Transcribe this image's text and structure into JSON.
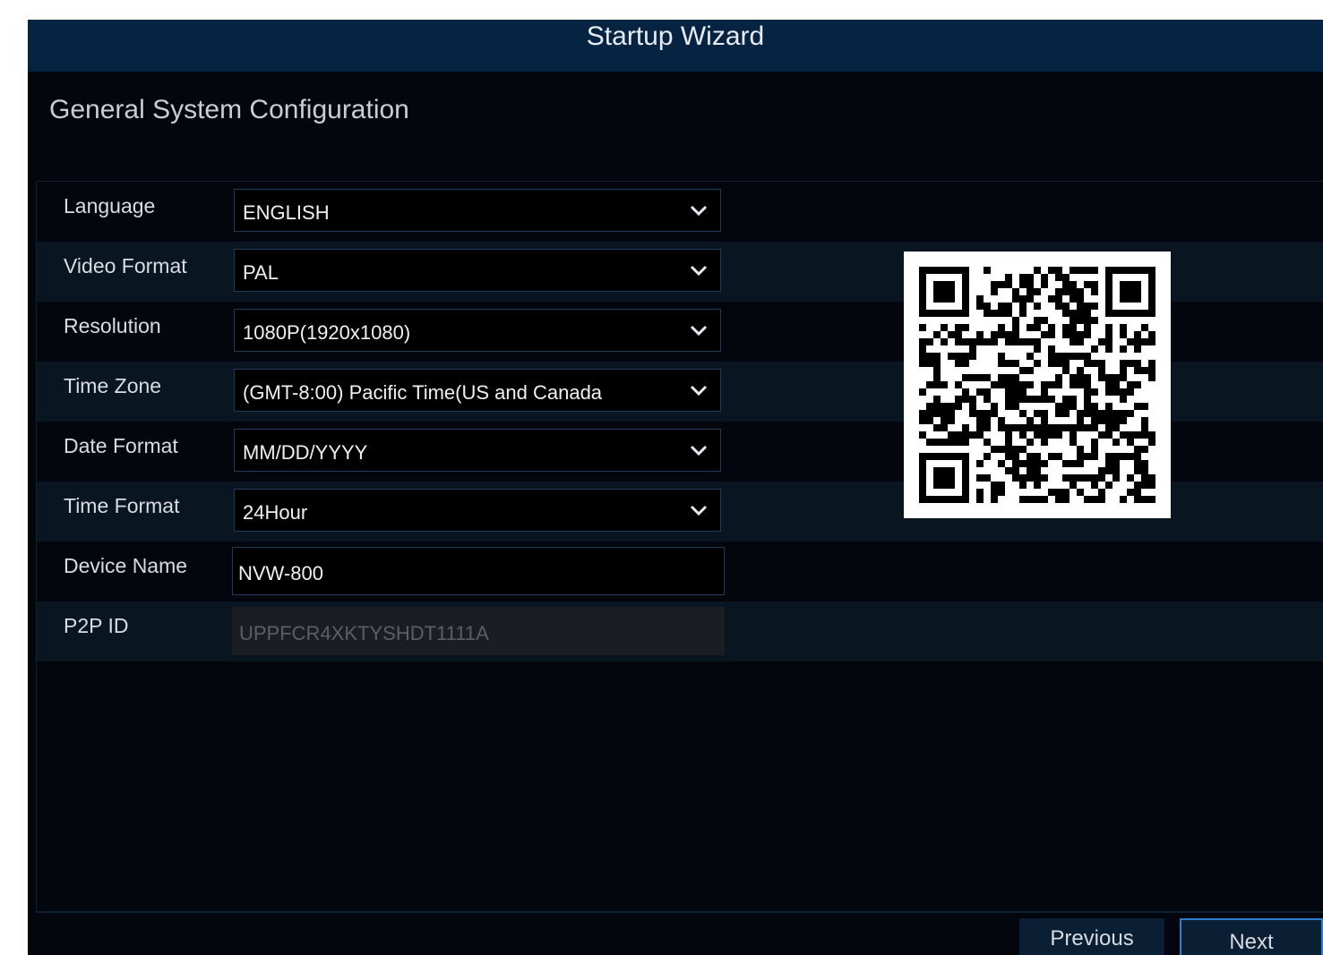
{
  "window": {
    "title": "Startup Wizard"
  },
  "section": {
    "title": "General System Configuration"
  },
  "fields": [
    {
      "label": "Language",
      "value": "ENGLISH",
      "type": "select"
    },
    {
      "label": "Video Format",
      "value": "PAL",
      "type": "select"
    },
    {
      "label": "Resolution",
      "value": "1080P(1920x1080)",
      "type": "select"
    },
    {
      "label": "Time Zone",
      "value": "(GMT-8:00) Pacific Time(US and Canada",
      "type": "select"
    },
    {
      "label": "Date Format",
      "value": "MM/DD/YYYY",
      "type": "select"
    },
    {
      "label": "Time Format",
      "value": "24Hour",
      "type": "select"
    },
    {
      "label": "Device Name",
      "value": "NVW-800",
      "type": "text"
    },
    {
      "label": "P2P ID",
      "value": "UPPFCR4XKTYSHDT1111A",
      "type": "readonly"
    }
  ],
  "buttons": {
    "previous": "Previous",
    "next": "Next"
  },
  "colors": {
    "title_bar": "#062441",
    "background": "#03070d",
    "accent": "#2b7fd1"
  },
  "icons": {
    "dropdown": "chevron-down-icon",
    "qr": "qr-code-icon"
  }
}
